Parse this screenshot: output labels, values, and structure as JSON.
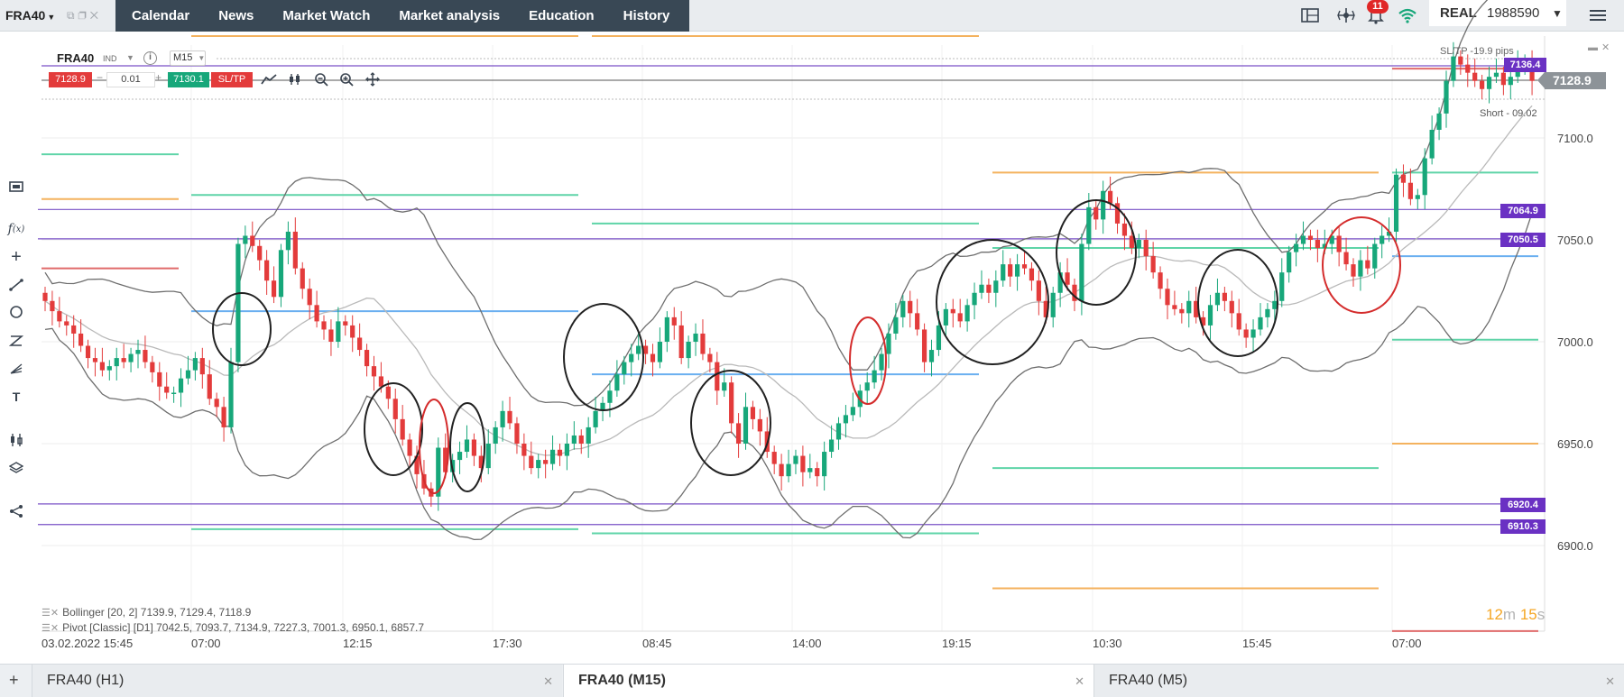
{
  "topbar": {
    "symbol": "FRA40",
    "nav": [
      "Calendar",
      "News",
      "Market Watch",
      "Market analysis",
      "Education",
      "History"
    ],
    "notifications": "11",
    "account_mode": "REAL",
    "account_number": "1988590"
  },
  "chart_header": {
    "symbol": "FRA40",
    "instrument_type": "IND",
    "timeframe": "M15",
    "sell_price": "7128.9",
    "quantity": "0.01",
    "buy_price": "7130.1",
    "sltp_label": "SL/TP"
  },
  "price_axis": {
    "labels": [
      "7100.0",
      "7050.0",
      "7000.0",
      "6950.0",
      "6900.0"
    ],
    "current_price": "7128.9",
    "position_tag": "7136.4",
    "level_tags": [
      "7064.9",
      "7050.5",
      "6920.4",
      "6910.3"
    ]
  },
  "annotations": {
    "pips": "SL/TP -19.9 pips",
    "short": "Short - 09.02"
  },
  "legend": {
    "bollinger": "Bollinger [20, 2] 7139.9, 7129.4, 7118.9",
    "pivot": "Pivot [Classic] [D1] 7042.5, 7093.7, 7134.9, 7227.3, 7001.3, 6950.1, 6857.7"
  },
  "timer": {
    "minutes": "12",
    "minutes_unit": "m",
    "seconds": "15",
    "seconds_unit": "s"
  },
  "time_axis": [
    "03.02.2022 15:45",
    "07:00",
    "12:15",
    "17:30",
    "08:45",
    "14:00",
    "19:15",
    "10:30",
    "15:45",
    "07:00"
  ],
  "tabs": [
    {
      "label": "FRA40 (H1)",
      "active": false
    },
    {
      "label": "FRA40 (M15)",
      "active": true
    },
    {
      "label": "FRA40 (M5)",
      "active": false
    }
  ],
  "chart_data": {
    "type": "candlestick",
    "symbol": "FRA40",
    "timeframe": "M15",
    "ylim": [
      6888,
      7148
    ],
    "y_ticks": [
      6900,
      6950,
      7000,
      7050,
      7100
    ],
    "colors": {
      "up": "#17a77a",
      "down": "#e33b3b",
      "bollinger": "#6e6e6e",
      "bollinger_mid": "#b9b9b9",
      "level_line": "#7a52c7",
      "pivot_green": "#5fd4a8",
      "pivot_orange": "#f4b25e",
      "pivot_red": "#e06b6b",
      "pivot_blue": "#6aaff0"
    },
    "closes": [
      7020,
      7015,
      7010,
      7008,
      7004,
      6998,
      6992,
      6990,
      6986,
      6988,
      6992,
      6990,
      6994,
      6996,
      6990,
      6985,
      6978,
      6975,
      6975,
      6982,
      6986,
      6992,
      6984,
      6972,
      6968,
      6958,
      6990,
      7048,
      7052,
      7047,
      7040,
      7030,
      7022,
      7045,
      7054,
      7036,
      7026,
      7018,
      7010,
      7006,
      7000,
      7010,
      7008,
      7002,
      6996,
      6988,
      6983,
      6978,
      6972,
      6962,
      6952,
      6944,
      6935,
      6928,
      6924,
      6948,
      6936,
      6942,
      6946,
      6952,
      6944,
      6938,
      6950,
      6958,
      6966,
      6960,
      6950,
      6944,
      6938,
      6942,
      6940,
      6947,
      6944,
      6950,
      6954,
      6950,
      6958,
      6966,
      6970,
      6976,
      6984,
      6990,
      6994,
      6998,
      6994,
      6990,
      7000,
      7012,
      7008,
      6992,
      7000,
      7004,
      6994,
      6990,
      6976,
      6980,
      6960,
      6950,
      6968,
      6962,
      6956,
      6946,
      6940,
      6934,
      6940,
      6944,
      6936,
      6938,
      6934,
      6946,
      6952,
      6960,
      6964,
      6968,
      6976,
      6980,
      6986,
      6994,
      7004,
      7012,
      7020,
      7014,
      7006,
      6990,
      6996,
      7008,
      7016,
      7014,
      7010,
      7018,
      7024,
      7028,
      7024,
      7030,
      7038,
      7032,
      7038,
      7036,
      7030,
      7020,
      7012,
      7024,
      7034,
      7028,
      7020,
      7048,
      7066,
      7060,
      7074,
      7068,
      7058,
      7052,
      7046,
      7050,
      7042,
      7034,
      7026,
      7018,
      7016,
      7014,
      7020,
      7012,
      7008,
      7018,
      7024,
      7020,
      7014,
      7006,
      7002,
      7006,
      7012,
      7016,
      7020,
      7034,
      7044,
      7048,
      7052,
      7050,
      7046,
      7048,
      7052,
      7044,
      7038,
      7032,
      7040,
      7036,
      7048,
      7052,
      7054,
      7082,
      7078,
      7070,
      7072,
      7090,
      7104,
      7112,
      7128,
      7140,
      7136,
      7132,
      7128,
      7124,
      7130,
      7132,
      7126,
      7130,
      7136,
      7138,
      7128
    ]
  }
}
